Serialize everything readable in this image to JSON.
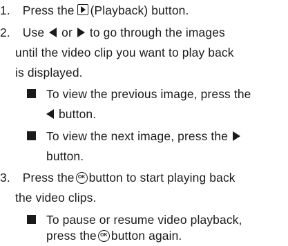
{
  "steps": [
    {
      "number": "1.",
      "lines": [
        {
          "before": "Press the",
          "icon": "playback-icon",
          "after": "(Playback) button."
        }
      ]
    },
    {
      "number": "2.",
      "lines": [
        {
          "before": "Use",
          "middle": "or",
          "after": "to go through the images"
        },
        {
          "text": "until the video clip you want to play back"
        },
        {
          "text": "is displayed."
        }
      ],
      "bullets": [
        {
          "line1": "To view the previous image, press the",
          "line2_after": "button."
        },
        {
          "line1_before": "To view the next image, press the",
          "line2": "button."
        }
      ]
    },
    {
      "number": "3.",
      "lines": [
        {
          "before": "Press the",
          "icon": "ok-icon",
          "after": "button to start playing back"
        },
        {
          "text": "the video clips."
        }
      ],
      "bullets": [
        {
          "line1": "To pause or resume video playback,",
          "line2_before": "press the",
          "line2_after": "button again."
        }
      ]
    }
  ],
  "icons": {
    "ok_label": "OK"
  }
}
